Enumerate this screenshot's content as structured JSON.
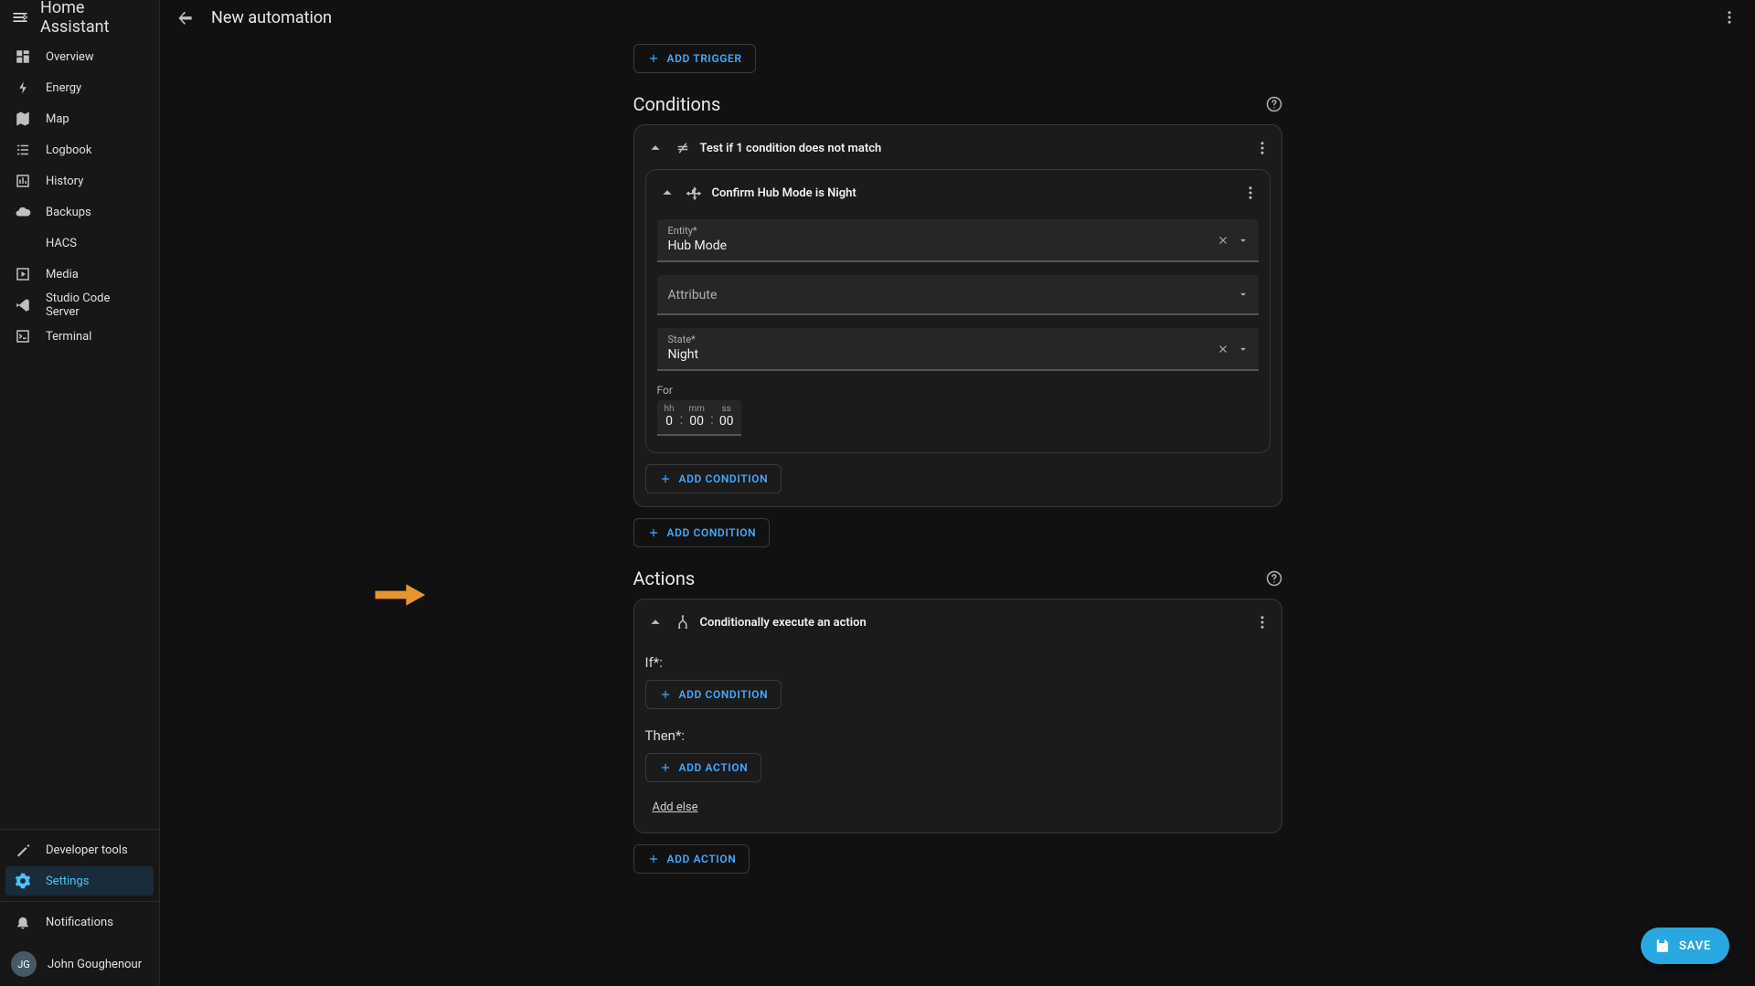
{
  "app": {
    "title": "Home Assistant"
  },
  "header": {
    "page_title": "New automation"
  },
  "sidebar": {
    "items": [
      {
        "label": "Overview"
      },
      {
        "label": "Energy"
      },
      {
        "label": "Map"
      },
      {
        "label": "Logbook"
      },
      {
        "label": "History"
      },
      {
        "label": "Backups"
      },
      {
        "label": "HACS"
      },
      {
        "label": "Media"
      },
      {
        "label": "Studio Code Server"
      },
      {
        "label": "Terminal"
      }
    ],
    "tools": [
      {
        "label": "Developer tools"
      },
      {
        "label": "Settings"
      }
    ],
    "notifications_label": "Notifications",
    "user": {
      "initials": "JG",
      "name": "John Goughenour"
    }
  },
  "buttons": {
    "add_trigger": "ADD TRIGGER",
    "add_condition": "ADD CONDITION",
    "add_action": "ADD ACTION",
    "add_else": "Add else",
    "save": "SAVE"
  },
  "sections": {
    "conditions_title": "Conditions",
    "actions_title": "Actions"
  },
  "conditions": {
    "outer_title": "Test if 1 condition does not match",
    "inner": {
      "title": "Confirm Hub Mode is Night",
      "entity_label": "Entity*",
      "entity_value": "Hub Mode",
      "attribute_label": "Attribute",
      "attribute_value": "",
      "state_label": "State*",
      "state_value": "Night",
      "for_label": "For",
      "hh_label": "hh",
      "mm_label": "mm",
      "ss_label": "ss",
      "hh": "0",
      "mm": "00",
      "ss": "00"
    }
  },
  "actions": {
    "card_title": "Conditionally execute an action",
    "if_label": "If*:",
    "then_label": "Then*:"
  }
}
